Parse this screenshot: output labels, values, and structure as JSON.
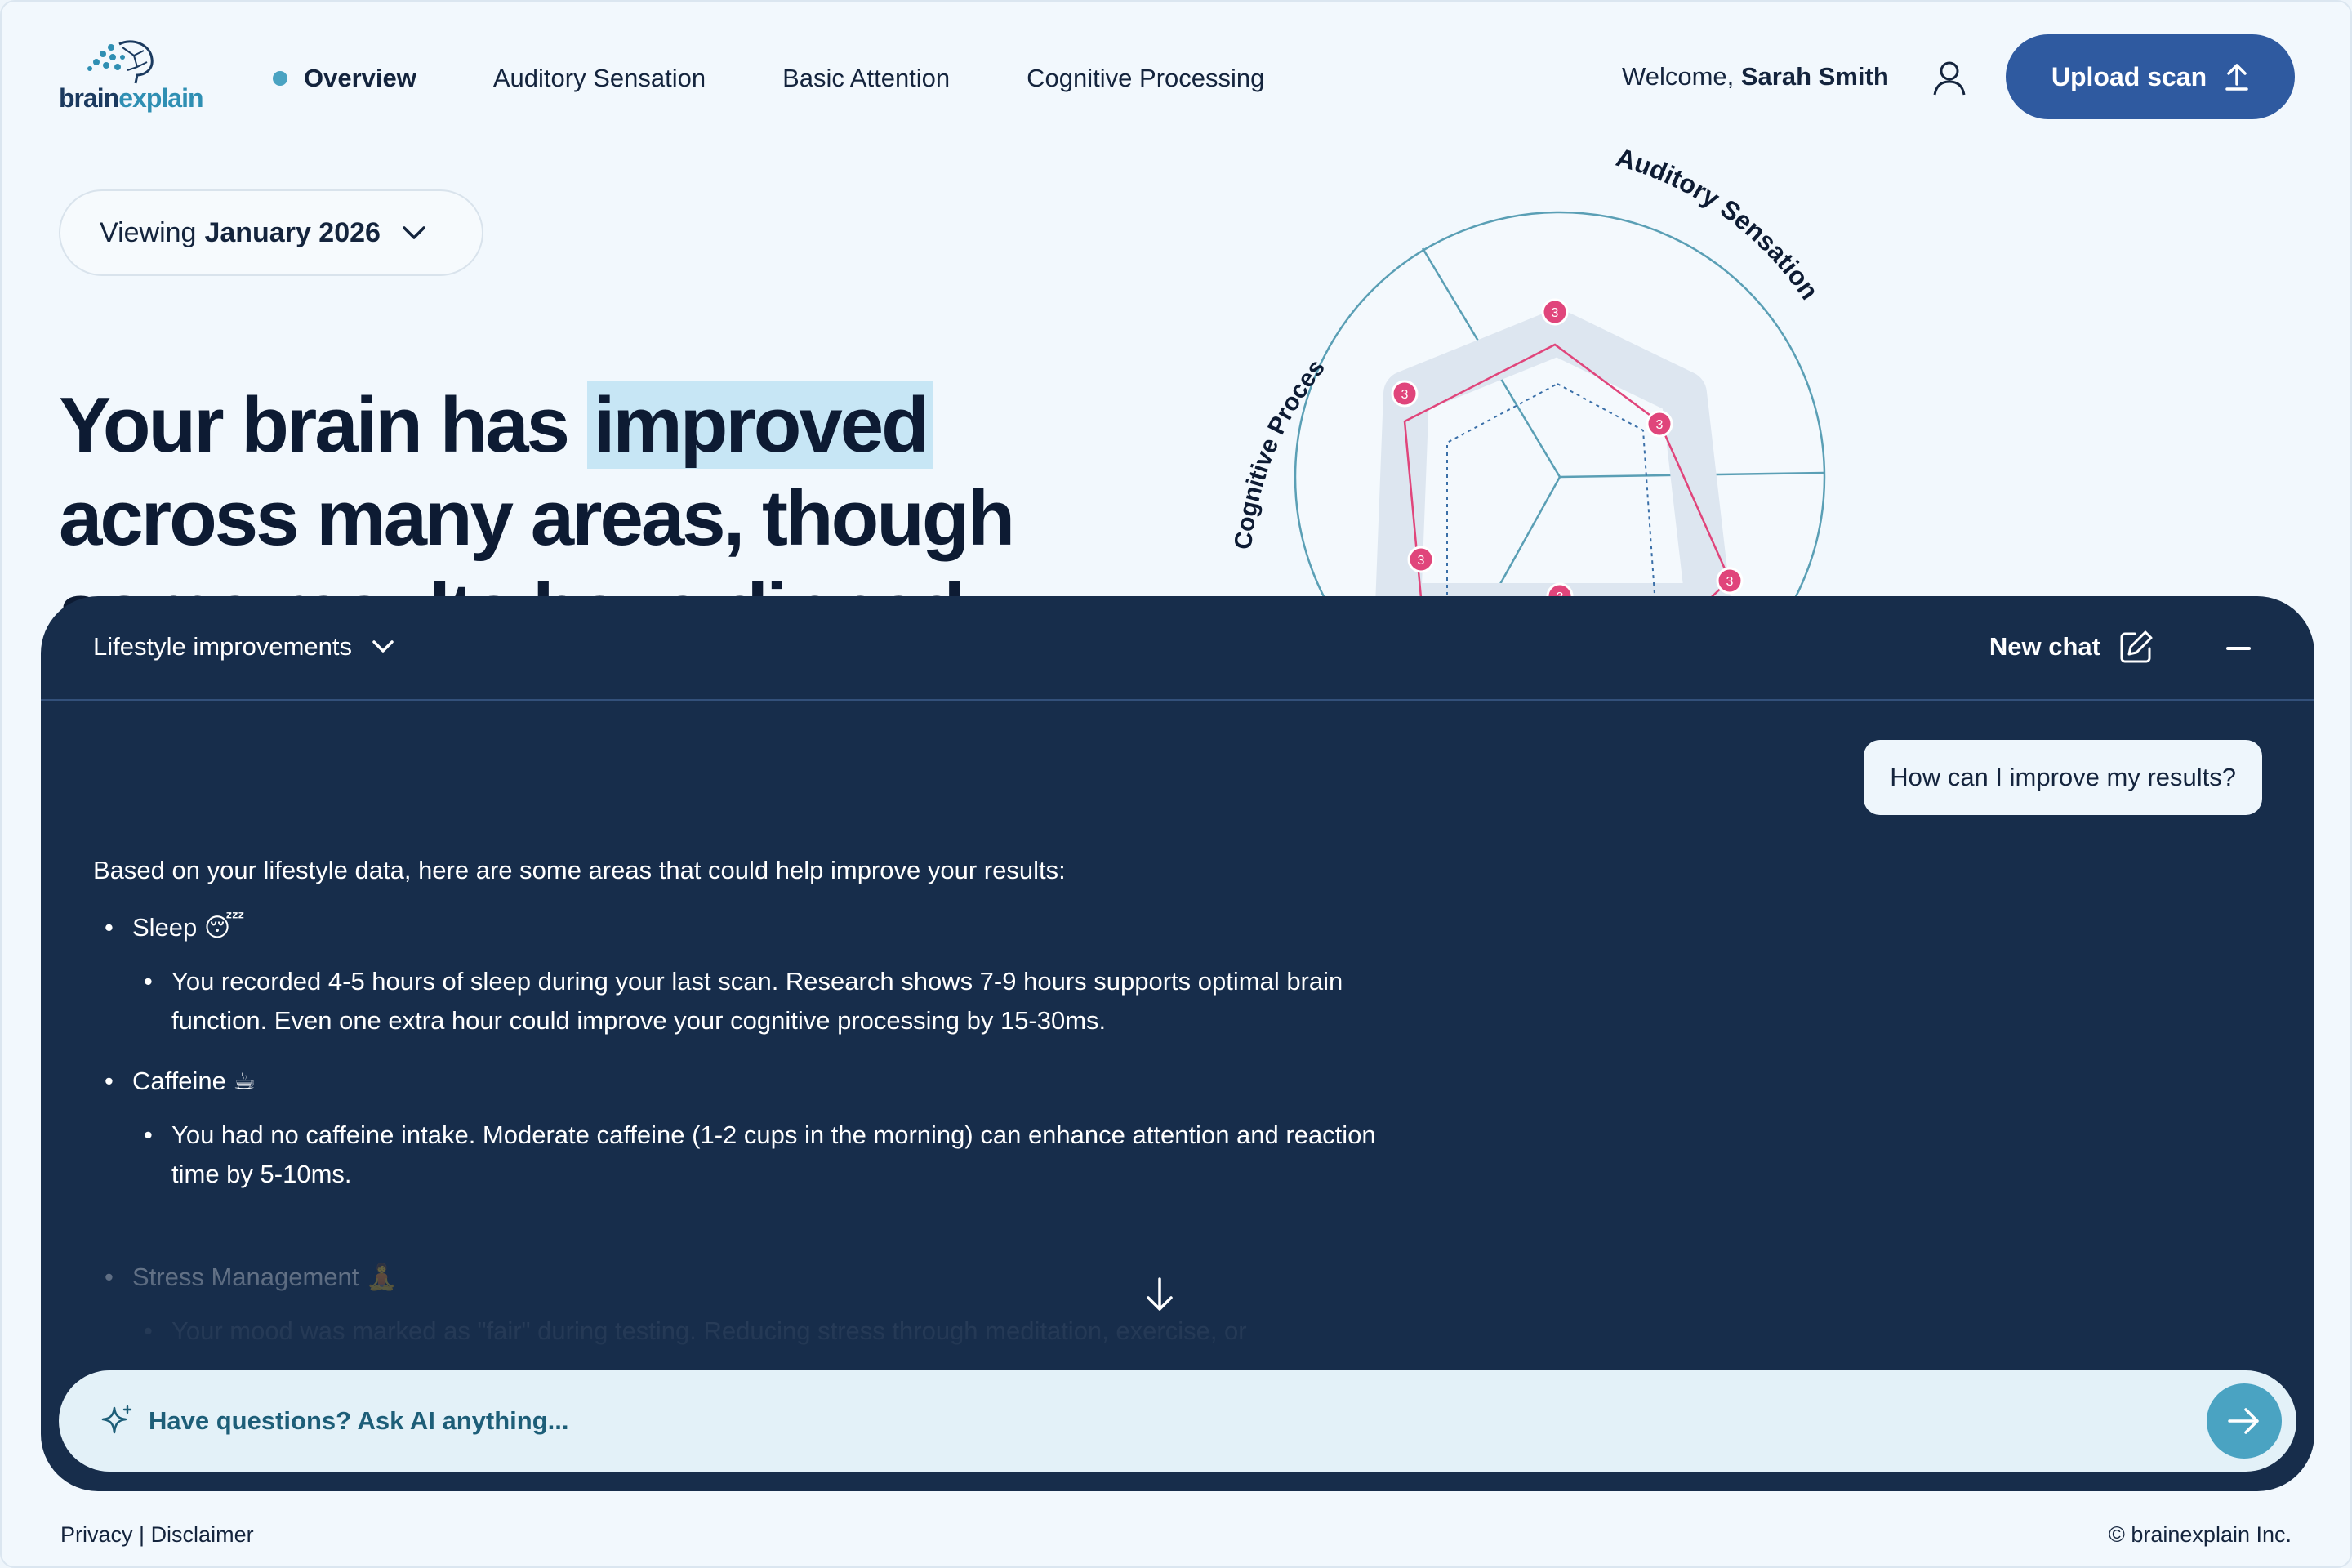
{
  "brand": {
    "name_part1": "brain",
    "name_part2": "explain",
    "colors": {
      "primary": "#2f5aa0",
      "accent": "#4aa3c2",
      "panel": "#172d4b",
      "marker": "#e0457b"
    }
  },
  "nav": {
    "items": [
      {
        "label": "Overview",
        "active": true
      },
      {
        "label": "Auditory Sensation",
        "active": false
      },
      {
        "label": "Basic Attention",
        "active": false
      },
      {
        "label": "Cognitive Processing",
        "active": false
      }
    ]
  },
  "header": {
    "welcome_prefix": "Welcome,",
    "user_name": "Sarah Smith",
    "user_icon": "user-icon",
    "upload_label": "Upload scan",
    "upload_icon": "upload-arrow-icon"
  },
  "viewing": {
    "prefix": "Viewing",
    "value": "January 2026",
    "icon": "chevron-down-icon"
  },
  "headline": {
    "part1": "Your brain has ",
    "highlight": "improved",
    "part2": "across many areas, though",
    "part3": "some results have dipped"
  },
  "radar": {
    "axis_labels": [
      "Auditory Sensation",
      "Cognitive Processing"
    ],
    "marker_values": [
      "3",
      "3",
      "3",
      "3",
      "3",
      "3"
    ]
  },
  "chat": {
    "topic": "Lifestyle improvements",
    "new_chat_label": "New chat",
    "user_message": "How can I improve my results?",
    "ai_intro": "Based on your lifestyle data, here are some areas that could help improve your results:",
    "items": [
      {
        "title": "Sleep",
        "emoji": "😴",
        "detail": "You recorded 4-5 hours of sleep during your last scan. Research shows 7-9 hours supports optimal brain function. Even one extra hour could improve your cognitive processing by 15-30ms."
      },
      {
        "title": "Caffeine",
        "emoji": "☕",
        "detail": "You had no caffeine intake. Moderate caffeine (1-2 cups in the morning) can enhance attention and reaction time by 5-10ms."
      },
      {
        "title": "Stress Management",
        "emoji": "🧘",
        "detail": "Your mood was marked as \"fair\" during testing. Reducing stress through meditation, exercise, or"
      }
    ],
    "input_placeholder": "Have questions? Ask AI anything..."
  },
  "footer": {
    "privacy": "Privacy",
    "separator": "|",
    "disclaimer": "Disclaimer",
    "copyright": "© brainexplain Inc."
  }
}
